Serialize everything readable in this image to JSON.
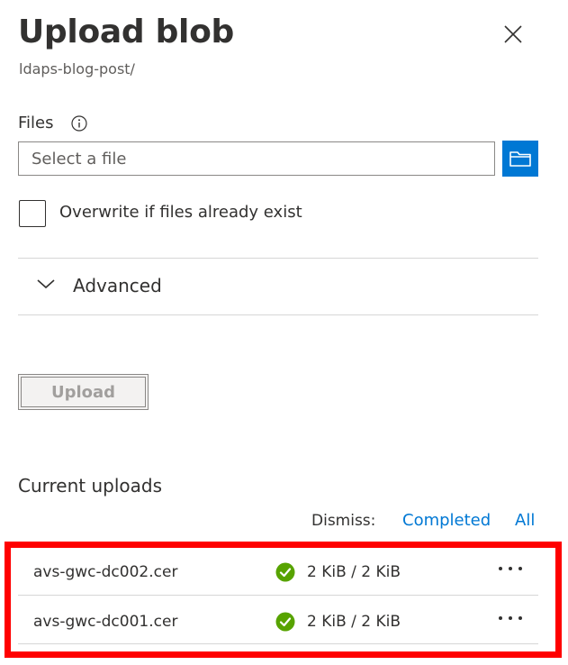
{
  "panel": {
    "title": "Upload blob",
    "subtitle": "ldaps-blog-post/",
    "close_icon": "close-icon"
  },
  "files": {
    "label": "Files",
    "info_icon": "info-icon",
    "placeholder": "Select a file",
    "value": "",
    "browse_icon": "folder-icon"
  },
  "overwrite": {
    "label": "Overwrite if files already exist",
    "checked": false
  },
  "advanced": {
    "label": "Advanced",
    "expanded": false,
    "icon": "chevron-down-icon"
  },
  "upload_button": {
    "label": "Upload",
    "disabled": true
  },
  "current_uploads": {
    "title": "Current uploads",
    "dismiss_label": "Dismiss:",
    "dismiss_links": [
      "Completed",
      "All"
    ],
    "items": [
      {
        "name": "avs-gwc-dc002.cer",
        "status": "completed",
        "progress": "2 KiB / 2 KiB"
      },
      {
        "name": "avs-gwc-dc001.cer",
        "status": "completed",
        "progress": "2 KiB / 2 KiB"
      }
    ]
  },
  "colors": {
    "accent": "#0078d4",
    "success": "#57a300",
    "highlight": "#ff0000"
  }
}
